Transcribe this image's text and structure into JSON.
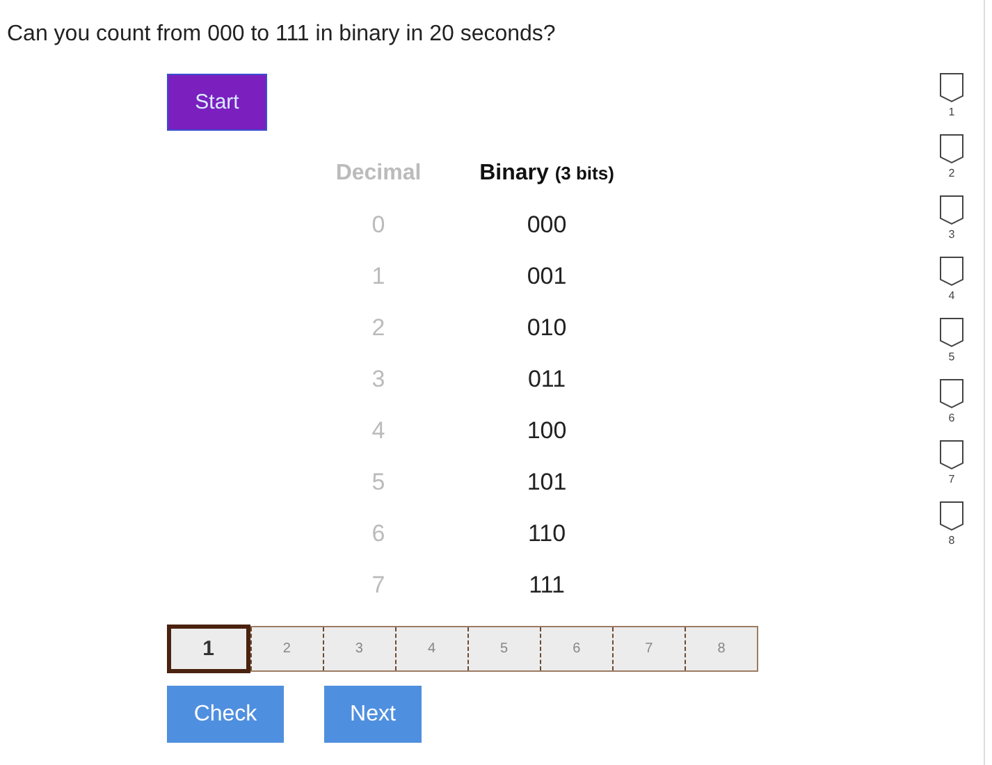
{
  "question": "Can you count from 000 to 111 in binary in 20 seconds?",
  "start_button": "Start",
  "table": {
    "columns": [
      {
        "label": "Decimal"
      },
      {
        "label": "Binary **(3 bits)**"
      }
    ],
    "rows": [
      {
        "decimal": "0",
        "binary": "000"
      },
      {
        "decimal": "1",
        "binary": "001"
      },
      {
        "decimal": "2",
        "binary": "010"
      },
      {
        "decimal": "3",
        "binary": "011"
      },
      {
        "decimal": "4",
        "binary": "100"
      },
      {
        "decimal": "5",
        "binary": "101"
      },
      {
        "decimal": "6",
        "binary": "110"
      },
      {
        "decimal": "7",
        "binary": "111"
      }
    ]
  },
  "steps": [
    {
      "label": "1",
      "selected": true
    },
    {
      "label": "2",
      "selected": false
    },
    {
      "label": "3",
      "selected": false
    },
    {
      "label": "4",
      "selected": false
    },
    {
      "label": "5",
      "selected": false
    },
    {
      "label": "6",
      "selected": false
    },
    {
      "label": "7",
      "selected": false
    },
    {
      "label": "8",
      "selected": false
    }
  ],
  "buttons": [
    "Check",
    "Next"
  ],
  "markers": [
    "1",
    "2",
    "3",
    "4",
    "5",
    "6",
    "7",
    "8"
  ]
}
